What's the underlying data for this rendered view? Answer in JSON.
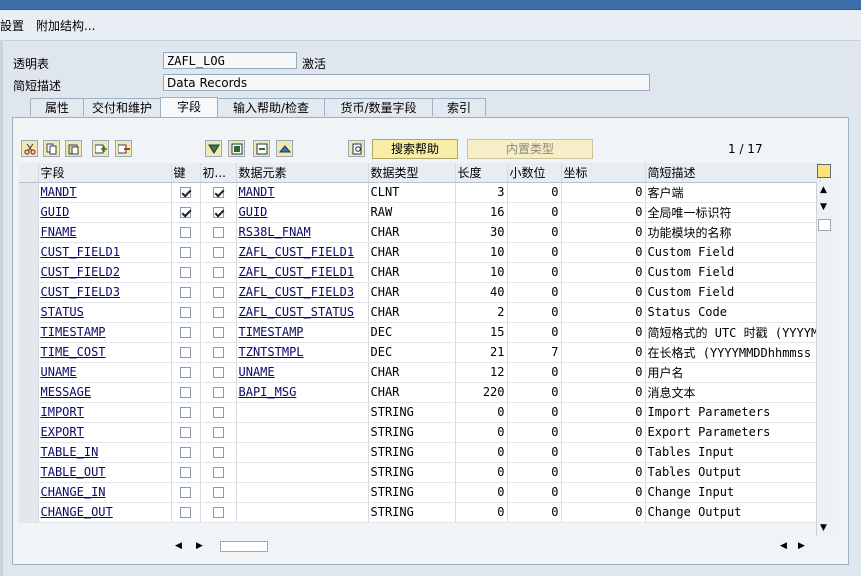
{
  "menu": {
    "item_settings": "設置",
    "item_append": "附加结构..."
  },
  "header": {
    "table_label": "透明表",
    "table_name": "ZAFL_LOG",
    "status": "激活",
    "desc_label": "简短描述",
    "desc_value": "Data Records"
  },
  "tabs": [
    "属性",
    "交付和维护",
    "字段",
    "输入帮助/检查",
    "货币/数量字段",
    "索引"
  ],
  "active_tab": "字段",
  "toolbar": {
    "search_help": "搜索帮助",
    "builtin_type": "内置类型",
    "pager": "1 / 17"
  },
  "columns": [
    "字段",
    "键",
    "初...",
    "数据元素",
    "数据类型",
    "长度",
    "小数位",
    "坐标",
    "简短描述"
  ],
  "rows": [
    {
      "field": "MANDT",
      "key": true,
      "init": true,
      "elem": "MANDT",
      "type": "CLNT",
      "len": "3",
      "dec": "0",
      "coord": "0",
      "desc": "客户端"
    },
    {
      "field": "GUID",
      "key": true,
      "init": true,
      "elem": "GUID",
      "type": "RAW",
      "len": "16",
      "dec": "0",
      "coord": "0",
      "desc": "全局唯一标识符"
    },
    {
      "field": "FNAME",
      "key": false,
      "init": false,
      "elem": "RS38L_FNAM",
      "type": "CHAR",
      "len": "30",
      "dec": "0",
      "coord": "0",
      "desc": "功能模块的名称"
    },
    {
      "field": "CUST_FIELD1",
      "key": false,
      "init": false,
      "elem": "ZAFL_CUST_FIELD1",
      "type": "CHAR",
      "len": "10",
      "dec": "0",
      "coord": "0",
      "desc": "Custom Field"
    },
    {
      "field": "CUST_FIELD2",
      "key": false,
      "init": false,
      "elem": "ZAFL_CUST_FIELD1",
      "type": "CHAR",
      "len": "10",
      "dec": "0",
      "coord": "0",
      "desc": "Custom Field"
    },
    {
      "field": "CUST_FIELD3",
      "key": false,
      "init": false,
      "elem": "ZAFL_CUST_FIELD3",
      "type": "CHAR",
      "len": "40",
      "dec": "0",
      "coord": "0",
      "desc": "Custom Field"
    },
    {
      "field": "STATUS",
      "key": false,
      "init": false,
      "elem": "ZAFL_CUST_STATUS",
      "type": "CHAR",
      "len": "2",
      "dec": "0",
      "coord": "0",
      "desc": "Status Code"
    },
    {
      "field": "TIMESTAMP",
      "key": false,
      "init": false,
      "elem": "TIMESTAMP",
      "type": "DEC",
      "len": "15",
      "dec": "0",
      "coord": "0",
      "desc": "简短格式的 UTC 时戳 (YYYYM"
    },
    {
      "field": "TIME_COST",
      "key": false,
      "init": false,
      "elem": "TZNTSTMPL",
      "type": "DEC",
      "len": "21",
      "dec": "7",
      "coord": "0",
      "desc": "在长格式 (YYYYMMDDhhmmss"
    },
    {
      "field": "UNAME",
      "key": false,
      "init": false,
      "elem": "UNAME",
      "type": "CHAR",
      "len": "12",
      "dec": "0",
      "coord": "0",
      "desc": "用户名"
    },
    {
      "field": "MESSAGE",
      "key": false,
      "init": false,
      "elem": "BAPI_MSG",
      "type": "CHAR",
      "len": "220",
      "dec": "0",
      "coord": "0",
      "desc": "消息文本"
    },
    {
      "field": "IMPORT",
      "key": false,
      "init": false,
      "elem": "",
      "type": "STRING",
      "len": "0",
      "dec": "0",
      "coord": "0",
      "desc": "Import Parameters"
    },
    {
      "field": "EXPORT",
      "key": false,
      "init": false,
      "elem": "",
      "type": "STRING",
      "len": "0",
      "dec": "0",
      "coord": "0",
      "desc": "Export Parameters"
    },
    {
      "field": "TABLE_IN",
      "key": false,
      "init": false,
      "elem": "",
      "type": "STRING",
      "len": "0",
      "dec": "0",
      "coord": "0",
      "desc": "Tables Input"
    },
    {
      "field": "TABLE_OUT",
      "key": false,
      "init": false,
      "elem": "",
      "type": "STRING",
      "len": "0",
      "dec": "0",
      "coord": "0",
      "desc": "Tables Output"
    },
    {
      "field": "CHANGE_IN",
      "key": false,
      "init": false,
      "elem": "",
      "type": "STRING",
      "len": "0",
      "dec": "0",
      "coord": "0",
      "desc": "Change Input"
    },
    {
      "field": "CHANGE_OUT",
      "key": false,
      "init": false,
      "elem": "",
      "type": "STRING",
      "len": "0",
      "dec": "0",
      "coord": "0",
      "desc": "Change Output"
    }
  ],
  "icons": [
    "cut-icon",
    "copy-icon",
    "paste-icon",
    "insert-row-icon",
    "delete-row-icon",
    "filter-icon",
    "expand-icon",
    "collapse-icon",
    "up-icon",
    "search-help-icon",
    "table-settings-icon"
  ]
}
